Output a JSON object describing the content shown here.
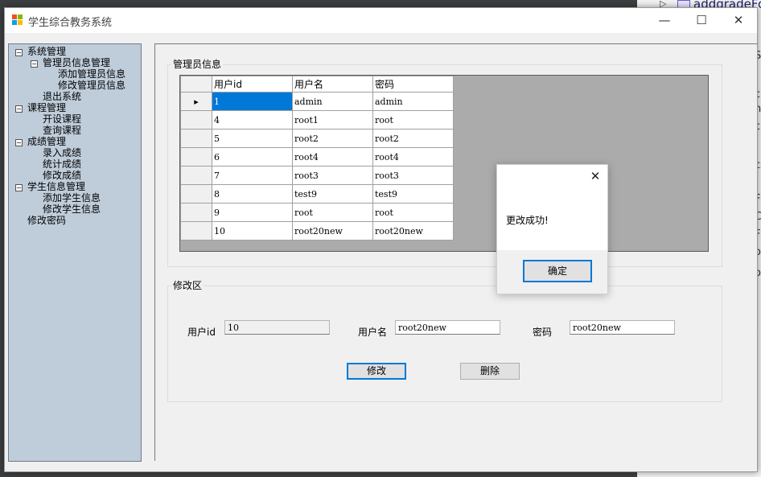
{
  "background_ide": {
    "tree_label": "addgradeForm",
    "edge_glyphs": [
      "S",
      "c",
      "n.",
      "c",
      "cs",
      "F",
      "C",
      "F",
      "o",
      "o",
      "t"
    ]
  },
  "window": {
    "title": "学生综合教务系统",
    "controls": {
      "minimize": "—",
      "maximize": "☐",
      "close": "✕"
    }
  },
  "tree": {
    "items": [
      {
        "label": "系统管理",
        "level": 0,
        "expander": "−"
      },
      {
        "label": "管理员信息管理",
        "level": 1,
        "expander": "−"
      },
      {
        "label": "添加管理员信息",
        "level": 2
      },
      {
        "label": "修改管理员信息",
        "level": 2
      },
      {
        "label": "退出系统",
        "level": 1
      },
      {
        "label": "课程管理",
        "level": 0,
        "expander": "−"
      },
      {
        "label": "开设课程",
        "level": 1
      },
      {
        "label": "查询课程",
        "level": 1
      },
      {
        "label": "成绩管理",
        "level": 0,
        "expander": "−"
      },
      {
        "label": "录入成绩",
        "level": 1
      },
      {
        "label": "统计成绩",
        "level": 1
      },
      {
        "label": "修改成绩",
        "level": 1
      },
      {
        "label": "学生信息管理",
        "level": 0,
        "expander": "−"
      },
      {
        "label": "添加学生信息",
        "level": 1
      },
      {
        "label": "修改学生信息",
        "level": 1
      },
      {
        "label": "修改密码",
        "level": 0
      }
    ]
  },
  "admin_group": {
    "title": "管理员信息",
    "columns": [
      "用户id",
      "用户名",
      "密码"
    ],
    "current_row_marker": "▸",
    "rows": [
      [
        "1",
        "admin",
        "admin"
      ],
      [
        "4",
        "root1",
        "root"
      ],
      [
        "5",
        "root2",
        "root2"
      ],
      [
        "6",
        "root4",
        "root4"
      ],
      [
        "7",
        "root3",
        "root3"
      ],
      [
        "8",
        "test9",
        "test9"
      ],
      [
        "9",
        "root",
        "root"
      ],
      [
        "10",
        "root20new",
        "root20new"
      ]
    ]
  },
  "edit_group": {
    "title": "修改区",
    "userid_label": "用户id",
    "userid_value": "10",
    "username_label": "用户名",
    "username_value": "root20new",
    "password_label": "密码",
    "password_value": "root20new",
    "modify_button": "修改",
    "delete_button": "删除"
  },
  "message_box": {
    "text": "更改成功!",
    "ok_button": "确定",
    "close": "✕"
  }
}
